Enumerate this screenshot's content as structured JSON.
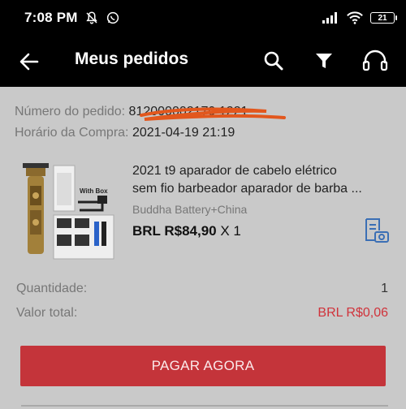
{
  "status_bar": {
    "time": "7:08 PM",
    "battery": "21",
    "icons": [
      "bell-off-icon",
      "whatsapp-icon",
      "signal-icon",
      "wifi-icon",
      "battery-icon"
    ]
  },
  "header": {
    "title": "Meus pedidos",
    "icons": [
      "back-arrow-icon",
      "search-icon",
      "filter-icon",
      "headset-icon"
    ]
  },
  "order": {
    "number_label": "Número do pedido:",
    "number_value": "812000002170 1221",
    "time_label": "Horário da Compra:",
    "time_value": "2021-04-19 21:19"
  },
  "product": {
    "title_line1": "2021 t9 aparador de cabelo elétrico",
    "title_line2": "sem fio barbeador aparador de barba ...",
    "seller": "Buddha Battery+China",
    "price": "BRL R$84,90",
    "quantity_suffix": "X 1",
    "image_text": "With Box"
  },
  "summary": {
    "quantity_label": "Quantidade:",
    "quantity_value": "1",
    "total_label": "Valor total:",
    "total_value": "BRL R$0,06"
  },
  "actions": {
    "pay_label": "PAGAR AGORA"
  },
  "colors": {
    "accent": "#c4343a",
    "total_price": "#d0333b",
    "link_icon": "#3b6fb5"
  }
}
